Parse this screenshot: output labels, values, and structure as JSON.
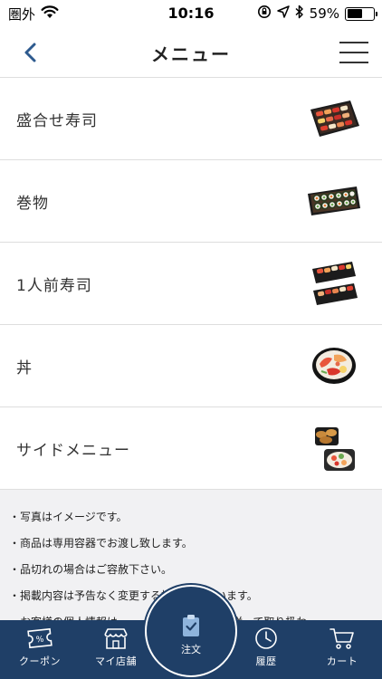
{
  "status_bar": {
    "carrier": "圏外",
    "time": "10:16",
    "battery_percent": "59%",
    "battery_level": 0.59
  },
  "nav": {
    "title": "メニュー"
  },
  "menu_items": [
    {
      "label": "盛合せ寿司",
      "image": "sushi-platter"
    },
    {
      "label": "巻物",
      "image": "sushi-rolls"
    },
    {
      "label": "1人前寿司",
      "image": "single-sushi-trays"
    },
    {
      "label": "丼",
      "image": "rice-bowl"
    },
    {
      "label": "サイドメニュー",
      "image": "side-dishes"
    }
  ],
  "notes": [
    "・写真はイメージです。",
    "・商品は専用容器でお渡し致します。",
    "・品切れの場合はご容赦下さい。",
    "・掲載内容は予告なく変更する場合がございます。",
    "・お客様の個人情報は、　　　　　　　　　に従って取り扱わ"
  ],
  "tabbar": {
    "coupon": "クーポン",
    "my_store": "マイ店舗",
    "order": "注文",
    "history": "履歴",
    "cart": "カート",
    "active": "order"
  },
  "colors": {
    "tabbar_bg": "#1f3f67",
    "nav_back": "#2d5a8e",
    "notes_bg": "#f1f1f3",
    "divider": "#dedede"
  }
}
